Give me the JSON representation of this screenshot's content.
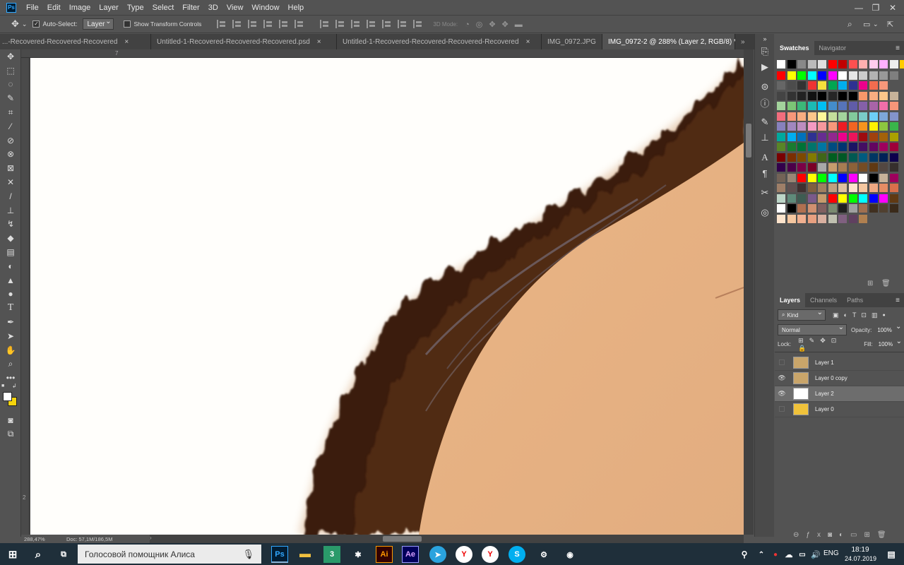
{
  "menu": {
    "app_badge": "Ps",
    "items": [
      "File",
      "Edit",
      "Image",
      "Layer",
      "Type",
      "Select",
      "Filter",
      "3D",
      "View",
      "Window",
      "Help"
    ]
  },
  "window_controls": {
    "minimize": "—",
    "restore": "❐",
    "close": "✕"
  },
  "options": {
    "auto_select_label": "Auto-Select:",
    "auto_select_value": "Layer",
    "transform_label": "Show Transform Controls",
    "mode3d_label": "3D Mode:"
  },
  "tabs": [
    {
      "label": "...-Recovered-Recovered-Recovered",
      "close": "×"
    },
    {
      "label": "Untitled-1-Recovered-Recovered-Recovered.psd",
      "close": "×"
    },
    {
      "label": "Untitled-1-Recovered-Recovered-Recovered-Recovered",
      "close": "×"
    },
    {
      "label": "IMG_0972.JPG",
      "close": "×"
    },
    {
      "label": "IMG_0972-2 @ 288% (Layer 2, RGB/8) *",
      "close": "×"
    }
  ],
  "tabs_overflow": "»",
  "ruler": {
    "top_label": "7",
    "left_label": "2"
  },
  "status": {
    "zoom": "288,47%",
    "doc": "Doc: 57,1M/186,5M"
  },
  "swatches_panel": {
    "tabs": [
      "Swatches",
      "Navigator"
    ]
  },
  "layers_panel": {
    "tabs": [
      "Layers",
      "Channels",
      "Paths"
    ],
    "kind_label": "Kind",
    "blend_mode": "Normal",
    "opacity_label": "Opacity:",
    "opacity_value": "100%",
    "lock_label": "Lock:",
    "fill_label": "Fill:",
    "fill_value": "100%",
    "layers": [
      {
        "name": "Layer 1",
        "visible": false,
        "selected": false
      },
      {
        "name": "Layer 0 copy",
        "visible": true,
        "selected": false
      },
      {
        "name": "Layer 2",
        "visible": true,
        "selected": true
      },
      {
        "name": "Layer 0",
        "visible": false,
        "selected": false
      }
    ]
  },
  "taskbar": {
    "search_text": "Голосовой помощник Алиса",
    "lang": "ENG",
    "time": "18:19",
    "date": "24.07.2019",
    "apps": [
      "Ps",
      "Ai",
      "Ae"
    ]
  },
  "colors": {
    "accent": "#31a8ff",
    "foreground": "#ffffff",
    "background": "#f5d40c"
  }
}
